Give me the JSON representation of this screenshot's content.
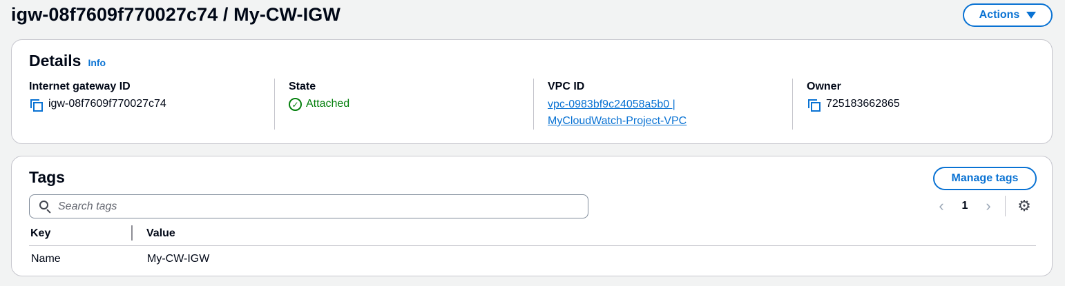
{
  "header": {
    "title": "igw-08f7609f770027c74 / My-CW-IGW",
    "actions_label": "Actions"
  },
  "details": {
    "title": "Details",
    "info_label": "Info",
    "columns": [
      {
        "label": "Internet gateway ID",
        "value": "igw-08f7609f770027c74"
      },
      {
        "label": "State",
        "value": "Attached"
      },
      {
        "label": "VPC ID",
        "value_line1": "vpc-0983bf9c24058a5b0 |",
        "value_line2": "MyCloudWatch-Project-VPC"
      },
      {
        "label": "Owner",
        "value": "725183662865"
      }
    ]
  },
  "tags": {
    "title": "Tags",
    "manage_label": "Manage tags",
    "search_placeholder": "Search tags",
    "page_number": "1",
    "columns": [
      "Key",
      "Value"
    ],
    "rows": [
      {
        "key": "Name",
        "value": "My-CW-IGW"
      }
    ]
  },
  "colors": {
    "accent": "#0972d3",
    "success": "#037f0c",
    "background": "#f2f3f3"
  }
}
